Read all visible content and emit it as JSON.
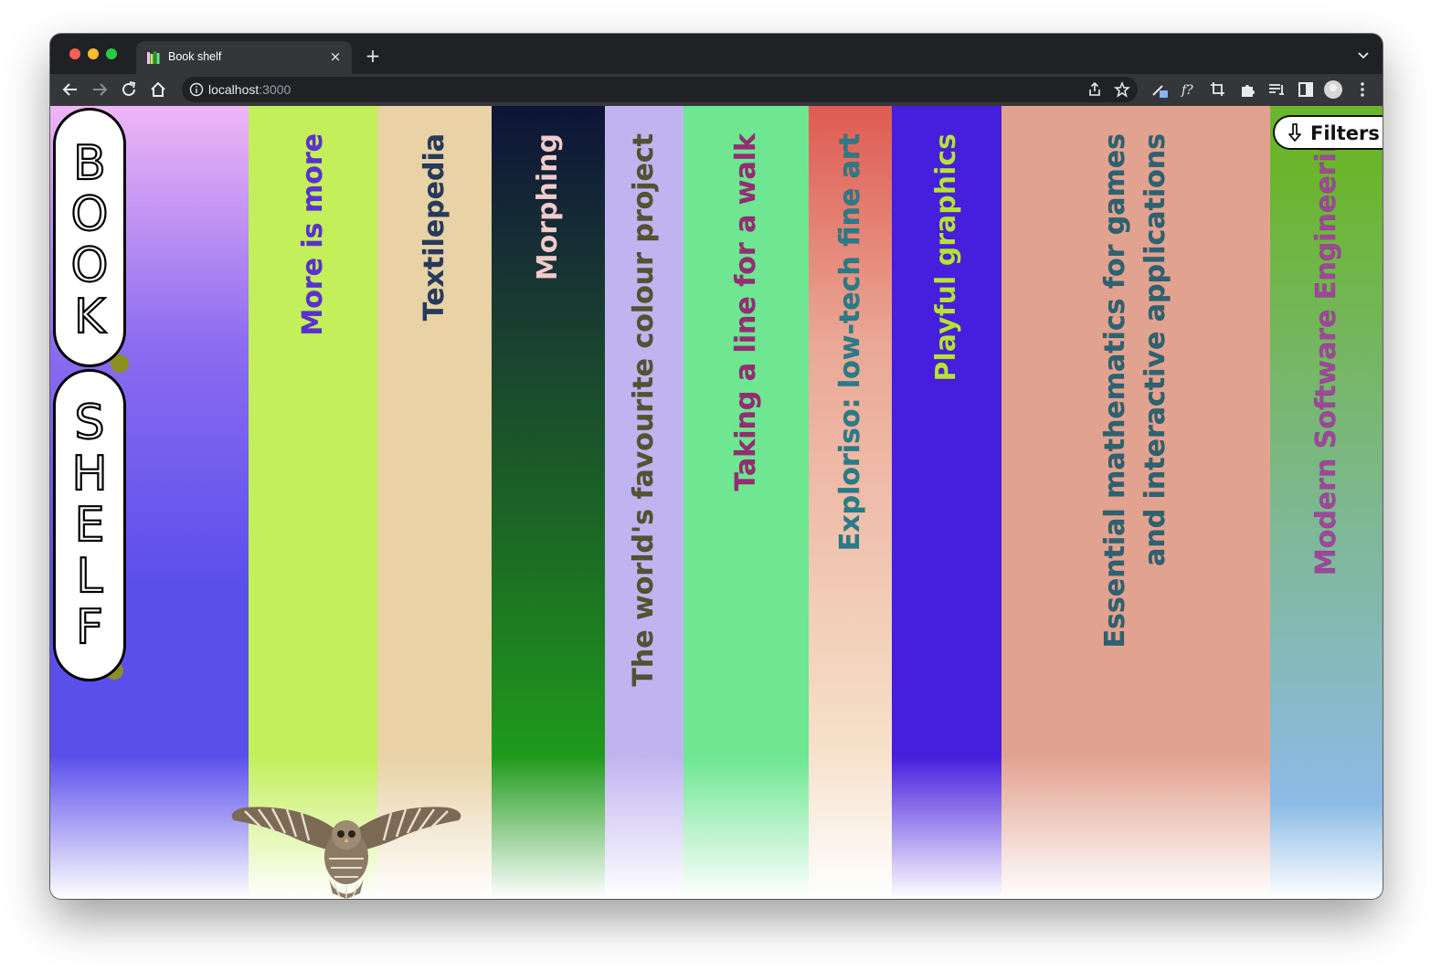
{
  "browser": {
    "tab_title": "Book shelf",
    "tab_close": "×",
    "new_tab": "+",
    "url_host": "localhost",
    "url_port": ":3000"
  },
  "logo": {
    "word1": [
      "B",
      "O",
      "O",
      "K"
    ],
    "word2": [
      "S",
      "H",
      "E",
      "L",
      "F"
    ]
  },
  "filters": {
    "label": "Filters",
    "icon": "arrow-down-icon"
  },
  "books": [
    {
      "title": "",
      "color_top": "#efb6f5",
      "color_bottom": "#5b4fec",
      "text_color": "#000000"
    },
    {
      "title": "More is more",
      "color_top": "#c3ef5a",
      "color_bottom": "#c3ef5a",
      "text_color": "#5b2fd8"
    },
    {
      "title": "Textilepedia",
      "color_top": "#e8d2a6",
      "color_bottom": "#e8d2a6",
      "text_color": "#263a5e"
    },
    {
      "title": "Morphing",
      "color_top": "#0e1438",
      "color_bottom": "#1f9a1c",
      "text_color": "#f1cccc"
    },
    {
      "title": "The world's favourite colour project",
      "color_top": "#c0b4f0",
      "color_bottom": "#c0b4f0",
      "text_color": "#545230"
    },
    {
      "title": "Taking a line for a walk",
      "color_top": "#6ee692",
      "color_bottom": "#6ee692",
      "text_color": "#9a2a76"
    },
    {
      "title": "Exploriso: low-tech fine art",
      "color_top": "#de5b52",
      "color_bottom": "#f6dfc8",
      "text_color": "#267d8a"
    },
    {
      "title": "Playful graphics",
      "color_top": "#461edd",
      "color_bottom": "#461edd",
      "text_color": "#b7e23a"
    },
    {
      "title": "Essential mathematics for games and interactive applications",
      "color_top": "#e2a290",
      "color_bottom": "#e2a290",
      "text_color": "#2b6372"
    },
    {
      "title": "Modern Software Engineerin",
      "color_top": "#6bb52c",
      "color_bottom": "#8cbbe7",
      "text_color": "#a1469c"
    }
  ]
}
